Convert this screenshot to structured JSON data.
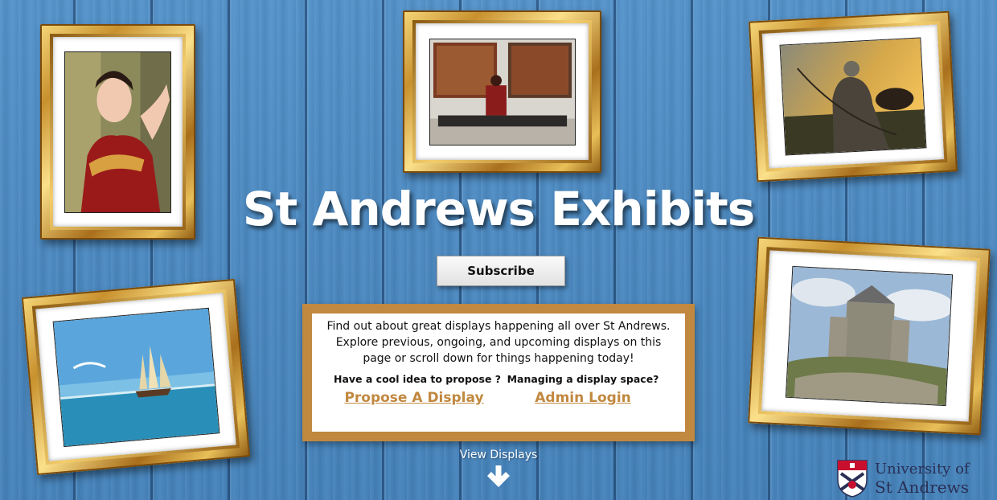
{
  "site_title": "St Andrews Exhibits",
  "subscribe_label": "Subscribe",
  "info": {
    "description": "Find out about great displays happening all over St Andrews. Explore previous, ongoing, and upcoming displays on this page or scroll down for things happening today!",
    "propose_question": "Have a cool idea to propose ?",
    "propose_link": "Propose A Display",
    "admin_question": "Managing a display space?",
    "admin_link": "Admin Login"
  },
  "view_displays_label": "View Displays",
  "university": {
    "line1": "University of",
    "line2": "St Andrews"
  },
  "colors": {
    "background": "#4f8dc4",
    "accent_gold": "#c1883f",
    "title_white": "#ffffff",
    "logo_navy": "#2a2f55"
  },
  "icons": {
    "view_displays": "down-arrow-icon",
    "logo": "crest-icon"
  }
}
